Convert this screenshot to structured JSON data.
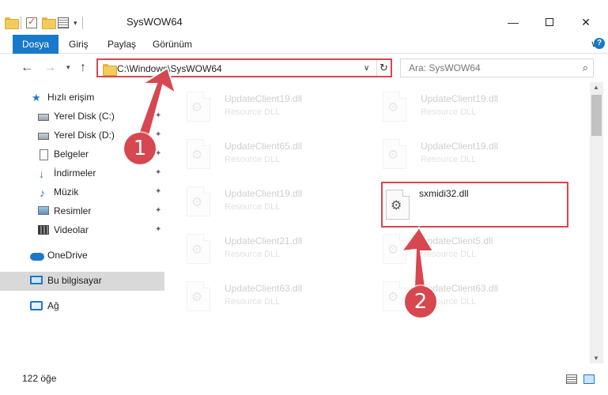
{
  "window": {
    "title": "SysWOW64",
    "minimize_glyph": "—",
    "close_glyph": "✕"
  },
  "ribbon": {
    "tabs": [
      {
        "label": "Dosya",
        "active": true
      },
      {
        "label": "Giriş"
      },
      {
        "label": "Paylaş"
      },
      {
        "label": "Görünüm"
      }
    ],
    "expand_glyph": "∨",
    "help_glyph": "?"
  },
  "nav": {
    "back_glyph": "←",
    "forward_glyph": "→",
    "recent_glyph": "▾",
    "up_glyph": "↑",
    "address_path": "C:\\Windows\\SysWOW64",
    "address_dropdown_glyph": "∨",
    "refresh_glyph": "↻",
    "search_placeholder": "Ara: SysWOW64",
    "search_glyph": "⌕"
  },
  "sidebar": {
    "pin_glyph": "✦",
    "items": [
      {
        "label": "Hızlı erişim",
        "icon": "star-icon"
      },
      {
        "label": "Yerel Disk (C:)",
        "icon": "drive-icon",
        "pinned": true
      },
      {
        "label": "Yerel Disk (D:)",
        "icon": "drive-icon",
        "pinned": true
      },
      {
        "label": "Belgeler",
        "icon": "document-icon",
        "pinned": true
      },
      {
        "label": "İndirmeler",
        "icon": "download-icon",
        "pinned": true
      },
      {
        "label": "Müzik",
        "icon": "music-icon",
        "pinned": true
      },
      {
        "label": "Resimler",
        "icon": "pictures-icon",
        "pinned": true
      },
      {
        "label": "Videolar",
        "icon": "videos-icon",
        "pinned": true
      },
      {
        "label": "OneDrive",
        "icon": "cloud-icon"
      },
      {
        "label": "Bu bilgisayar",
        "icon": "computer-icon",
        "selected": true
      },
      {
        "label": "Ağ",
        "icon": "network-icon"
      }
    ]
  },
  "files": [
    {
      "name": "UpdateClient19.dll",
      "type": "Resource DLL"
    },
    {
      "name": "UpdateClient19.dll",
      "type": "Resource DLL"
    },
    {
      "name": "UpdateClient65.dll",
      "type": "Resource DLL"
    },
    {
      "name": "UpdateClient19.dll",
      "type": "Resource DLL"
    },
    {
      "name": "UpdateClient19.dll",
      "type": "Resource DLL"
    },
    {
      "name": "sxmidi32.dll",
      "type": "",
      "highlighted": true
    },
    {
      "name": "UpdateClient21.dll",
      "type": "Resource DLL"
    },
    {
      "name": "UpdateClient5.dll",
      "type": "Resource DLL"
    },
    {
      "name": "UpdateClient63.dll",
      "type": "Resource DLL"
    },
    {
      "name": "UpdateClient63.dll",
      "type": "Resource DLL"
    }
  ],
  "scrollbar": {
    "up_glyph": "▲",
    "down_glyph": "▼"
  },
  "status": {
    "item_count": "122 öğe"
  },
  "annotations": {
    "step1": "1",
    "step2": "2",
    "accent_color": "#d7474f"
  },
  "colors": {
    "ribbon_active": "#1979ca",
    "selection": "#d9d9d9"
  }
}
